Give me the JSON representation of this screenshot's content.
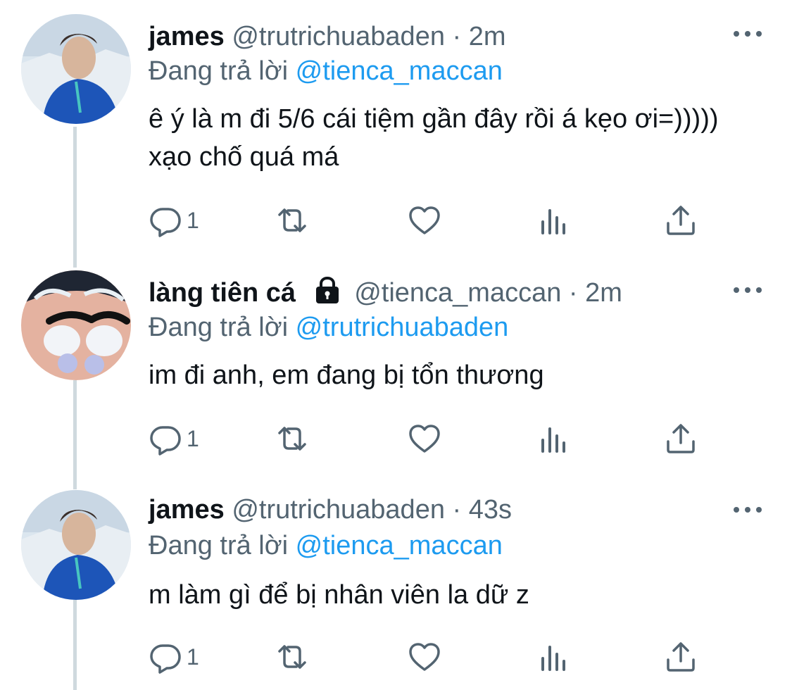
{
  "tweets": [
    {
      "name": "james",
      "handle": "@trutrichuabaden",
      "time": "2m",
      "reply_prefix": "Đang trả lời ",
      "reply_to": "@tienca_maccan",
      "text": "ê ý là m đi 5/6 cái tiệm gần đây rồi á kẹo ơi=))))) xạo chố quá má",
      "reply_count": "1",
      "locked": false
    },
    {
      "name": "làng tiên cá",
      "handle": "@tienca_maccan",
      "time": "2m",
      "reply_prefix": "Đang trả lời ",
      "reply_to": "@trutrichuabaden",
      "text": "im đi anh, em đang bị tổn thương",
      "reply_count": "1",
      "locked": true
    },
    {
      "name": "james",
      "handle": "@trutrichuabaden",
      "time": "43s",
      "reply_prefix": "Đang trả lời ",
      "reply_to": "@tienca_maccan",
      "text": "m làm gì để bị nhân viên la dữ z",
      "reply_count": "1",
      "locked": false
    }
  ],
  "separator": "·",
  "icons": {
    "reply": "reply-icon",
    "retweet": "retweet-icon",
    "like": "heart-icon",
    "analytics": "analytics-icon",
    "share": "share-icon",
    "more": "more-icon",
    "lock": "lock-icon"
  },
  "colors": {
    "mention": "#1d9bf0",
    "secondary_text": "#536471",
    "thread_line": "#cfd9de"
  }
}
